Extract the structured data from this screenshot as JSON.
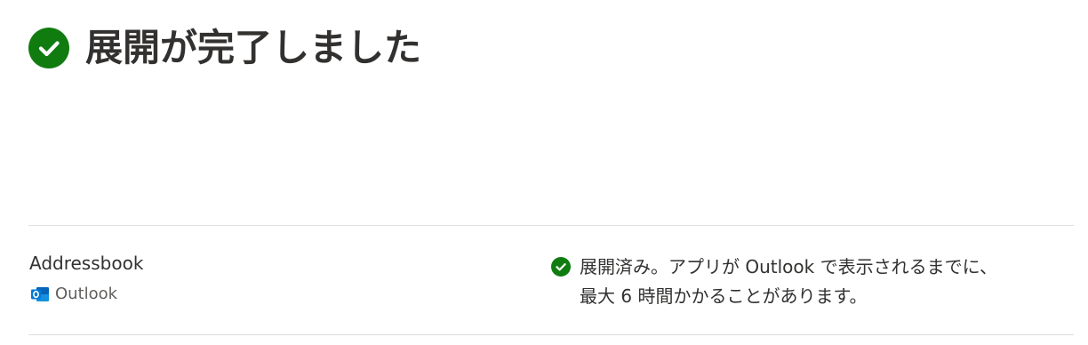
{
  "header": {
    "title": "展開が完了しました",
    "icon": "check-circle-icon",
    "icon_color": "#107c10"
  },
  "deployment": {
    "app_name": "Addressbook",
    "host": {
      "icon": "outlook-icon",
      "label": "Outlook",
      "icon_color": "#0078d4"
    },
    "status": {
      "icon": "check-circle-icon",
      "icon_color": "#107c10",
      "line1": "展開済み。アプリが Outlook で表示されるまでに、",
      "line2": "最大 6 時間かかることがあります。"
    }
  }
}
